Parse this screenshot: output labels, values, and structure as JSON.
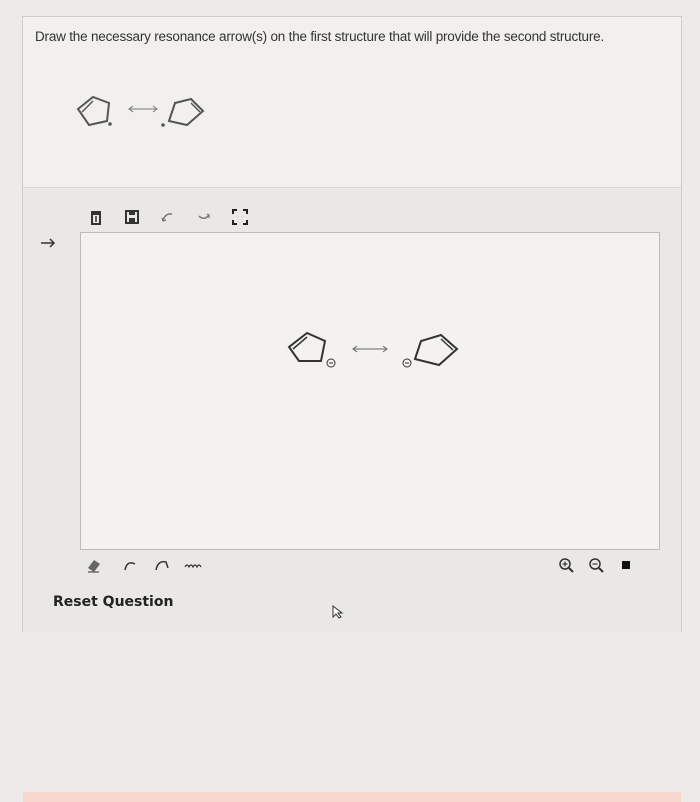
{
  "question": {
    "text": "Draw the necessary resonance arrow(s) on the first structure that will provide the second structure."
  },
  "structures": {
    "left_charge": "⊖",
    "right_charge": "⊖"
  },
  "toolbar_top": {
    "items": [
      "trash-icon",
      "save-icon",
      "curved-arrow-left-icon",
      "curved-arrow-right-icon",
      "fullscreen-icon"
    ]
  },
  "toolbar_bottom": {
    "left_items": [
      "eraser-icon",
      "single-electron-arrow-icon",
      "double-electron-arrow-icon",
      "wavy-bond-icon"
    ],
    "right_items": [
      "zoom-in-icon",
      "zoom-out-icon",
      "color-square-icon"
    ]
  },
  "reset": {
    "label": "Reset Question"
  }
}
